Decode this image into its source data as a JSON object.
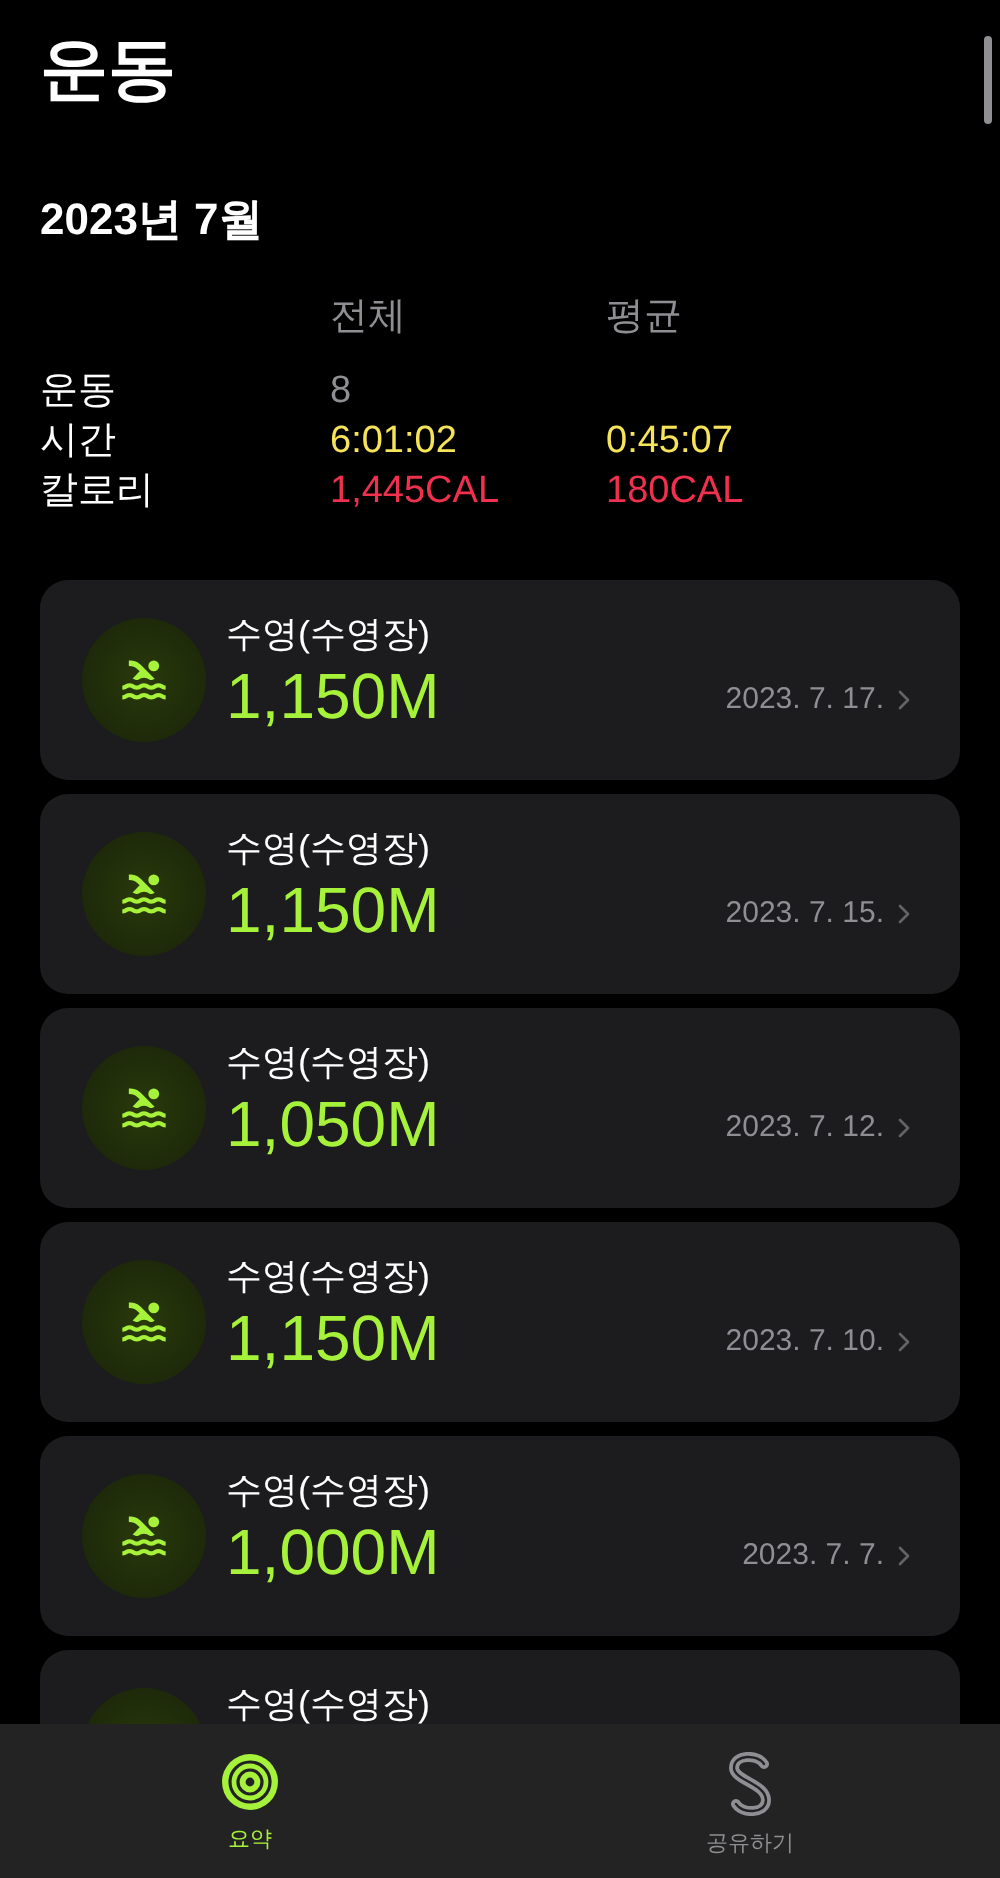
{
  "title": "운동",
  "period": "2023년 7월",
  "summary": {
    "columns": [
      "전체",
      "평균"
    ],
    "rows": [
      {
        "label": "운동",
        "kind": "count",
        "values": [
          "8"
        ]
      },
      {
        "label": "시간",
        "kind": "time",
        "values": [
          "6:01:02",
          "0:45:07"
        ]
      },
      {
        "label": "칼로리",
        "kind": "calories",
        "values": [
          "1,445CAL",
          "180CAL"
        ]
      }
    ]
  },
  "workouts": [
    {
      "name": "수영(수영장)",
      "distance": "1,150M",
      "date": "2023. 7. 17."
    },
    {
      "name": "수영(수영장)",
      "distance": "1,150M",
      "date": "2023. 7. 15."
    },
    {
      "name": "수영(수영장)",
      "distance": "1,050M",
      "date": "2023. 7. 12."
    },
    {
      "name": "수영(수영장)",
      "distance": "1,150M",
      "date": "2023. 7. 10."
    },
    {
      "name": "수영(수영장)",
      "distance": "1,000M",
      "date": "2023. 7. 7."
    },
    {
      "name": "수영(수영장)"
    }
  ],
  "tab_bar": [
    {
      "label": "요약",
      "kind": "summary",
      "selected": true
    },
    {
      "label": "공유하기",
      "kind": "sharing",
      "selected": false
    }
  ]
}
